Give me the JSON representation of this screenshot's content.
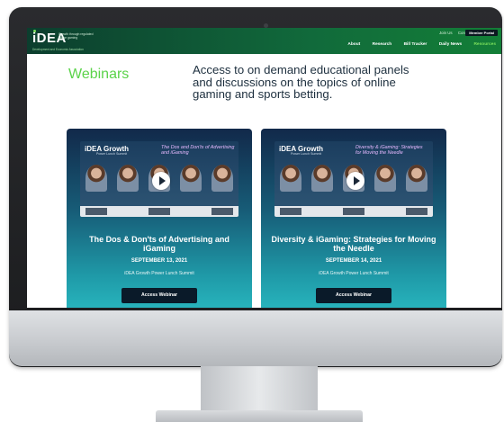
{
  "header": {
    "logo_text": "iDEA",
    "logo_tagline": "Growth through regulated online gaming",
    "logo_subline": "Development and Economic Association",
    "top_links": [
      "Join Us",
      "Contact"
    ],
    "portal_button": "Member Portal",
    "nav": [
      "About",
      "Research",
      "Bill Tracker",
      "Daily News",
      "Resources"
    ],
    "active_nav": "Resources"
  },
  "hero": {
    "title": "Webinars",
    "description": "Access to on demand educational panels and discussions on the topics of online gaming and sports betting."
  },
  "webinars": [
    {
      "thumb_brand": "iDEA Growth",
      "thumb_brand_sub": "Power Lunch Summit",
      "thumb_title": "The Dos and Don'ts of Advertising and iGaming",
      "title": "The Dos & Don'ts of Advertising and iGaming",
      "date": "SEPTEMBER 13, 2021",
      "series": "iDEA Growth Power Lunch Summit",
      "button": "Access Webinar"
    },
    {
      "thumb_brand": "iDEA Growth",
      "thumb_brand_sub": "Power Lunch Summit",
      "thumb_title": "Diversity & iGaming: Strategies for Moving the Needle",
      "title": "Diversity & iGaming: Strategies for Moving the Needle",
      "date": "SEPTEMBER 14, 2021",
      "series": "iDEA Growth Power Lunch Summit",
      "button": "Access Webinar"
    }
  ]
}
